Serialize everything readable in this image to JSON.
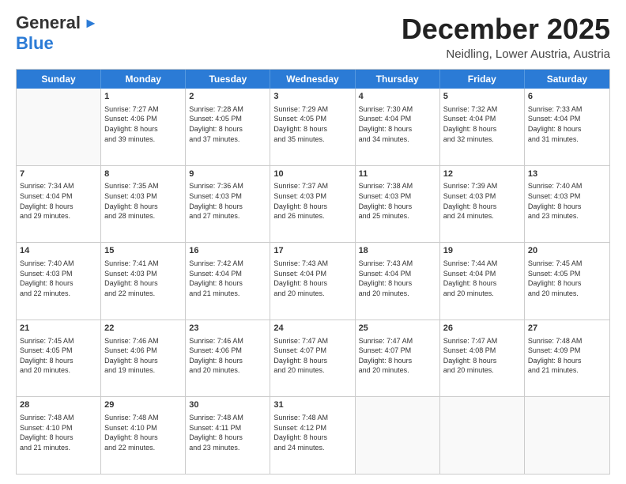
{
  "header": {
    "logo_general": "General",
    "logo_blue": "Blue",
    "month_title": "December 2025",
    "location": "Neidling, Lower Austria, Austria"
  },
  "days_of_week": [
    "Sunday",
    "Monday",
    "Tuesday",
    "Wednesday",
    "Thursday",
    "Friday",
    "Saturday"
  ],
  "weeks": [
    [
      {
        "day": "",
        "info": ""
      },
      {
        "day": "1",
        "info": "Sunrise: 7:27 AM\nSunset: 4:06 PM\nDaylight: 8 hours\nand 39 minutes."
      },
      {
        "day": "2",
        "info": "Sunrise: 7:28 AM\nSunset: 4:05 PM\nDaylight: 8 hours\nand 37 minutes."
      },
      {
        "day": "3",
        "info": "Sunrise: 7:29 AM\nSunset: 4:05 PM\nDaylight: 8 hours\nand 35 minutes."
      },
      {
        "day": "4",
        "info": "Sunrise: 7:30 AM\nSunset: 4:04 PM\nDaylight: 8 hours\nand 34 minutes."
      },
      {
        "day": "5",
        "info": "Sunrise: 7:32 AM\nSunset: 4:04 PM\nDaylight: 8 hours\nand 32 minutes."
      },
      {
        "day": "6",
        "info": "Sunrise: 7:33 AM\nSunset: 4:04 PM\nDaylight: 8 hours\nand 31 minutes."
      }
    ],
    [
      {
        "day": "7",
        "info": "Sunrise: 7:34 AM\nSunset: 4:04 PM\nDaylight: 8 hours\nand 29 minutes."
      },
      {
        "day": "8",
        "info": "Sunrise: 7:35 AM\nSunset: 4:03 PM\nDaylight: 8 hours\nand 28 minutes."
      },
      {
        "day": "9",
        "info": "Sunrise: 7:36 AM\nSunset: 4:03 PM\nDaylight: 8 hours\nand 27 minutes."
      },
      {
        "day": "10",
        "info": "Sunrise: 7:37 AM\nSunset: 4:03 PM\nDaylight: 8 hours\nand 26 minutes."
      },
      {
        "day": "11",
        "info": "Sunrise: 7:38 AM\nSunset: 4:03 PM\nDaylight: 8 hours\nand 25 minutes."
      },
      {
        "day": "12",
        "info": "Sunrise: 7:39 AM\nSunset: 4:03 PM\nDaylight: 8 hours\nand 24 minutes."
      },
      {
        "day": "13",
        "info": "Sunrise: 7:40 AM\nSunset: 4:03 PM\nDaylight: 8 hours\nand 23 minutes."
      }
    ],
    [
      {
        "day": "14",
        "info": "Sunrise: 7:40 AM\nSunset: 4:03 PM\nDaylight: 8 hours\nand 22 minutes."
      },
      {
        "day": "15",
        "info": "Sunrise: 7:41 AM\nSunset: 4:03 PM\nDaylight: 8 hours\nand 22 minutes."
      },
      {
        "day": "16",
        "info": "Sunrise: 7:42 AM\nSunset: 4:04 PM\nDaylight: 8 hours\nand 21 minutes."
      },
      {
        "day": "17",
        "info": "Sunrise: 7:43 AM\nSunset: 4:04 PM\nDaylight: 8 hours\nand 20 minutes."
      },
      {
        "day": "18",
        "info": "Sunrise: 7:43 AM\nSunset: 4:04 PM\nDaylight: 8 hours\nand 20 minutes."
      },
      {
        "day": "19",
        "info": "Sunrise: 7:44 AM\nSunset: 4:04 PM\nDaylight: 8 hours\nand 20 minutes."
      },
      {
        "day": "20",
        "info": "Sunrise: 7:45 AM\nSunset: 4:05 PM\nDaylight: 8 hours\nand 20 minutes."
      }
    ],
    [
      {
        "day": "21",
        "info": "Sunrise: 7:45 AM\nSunset: 4:05 PM\nDaylight: 8 hours\nand 20 minutes."
      },
      {
        "day": "22",
        "info": "Sunrise: 7:46 AM\nSunset: 4:06 PM\nDaylight: 8 hours\nand 19 minutes."
      },
      {
        "day": "23",
        "info": "Sunrise: 7:46 AM\nSunset: 4:06 PM\nDaylight: 8 hours\nand 20 minutes."
      },
      {
        "day": "24",
        "info": "Sunrise: 7:47 AM\nSunset: 4:07 PM\nDaylight: 8 hours\nand 20 minutes."
      },
      {
        "day": "25",
        "info": "Sunrise: 7:47 AM\nSunset: 4:07 PM\nDaylight: 8 hours\nand 20 minutes."
      },
      {
        "day": "26",
        "info": "Sunrise: 7:47 AM\nSunset: 4:08 PM\nDaylight: 8 hours\nand 20 minutes."
      },
      {
        "day": "27",
        "info": "Sunrise: 7:48 AM\nSunset: 4:09 PM\nDaylight: 8 hours\nand 21 minutes."
      }
    ],
    [
      {
        "day": "28",
        "info": "Sunrise: 7:48 AM\nSunset: 4:10 PM\nDaylight: 8 hours\nand 21 minutes."
      },
      {
        "day": "29",
        "info": "Sunrise: 7:48 AM\nSunset: 4:10 PM\nDaylight: 8 hours\nand 22 minutes."
      },
      {
        "day": "30",
        "info": "Sunrise: 7:48 AM\nSunset: 4:11 PM\nDaylight: 8 hours\nand 23 minutes."
      },
      {
        "day": "31",
        "info": "Sunrise: 7:48 AM\nSunset: 4:12 PM\nDaylight: 8 hours\nand 24 minutes."
      },
      {
        "day": "",
        "info": ""
      },
      {
        "day": "",
        "info": ""
      },
      {
        "day": "",
        "info": ""
      }
    ]
  ]
}
